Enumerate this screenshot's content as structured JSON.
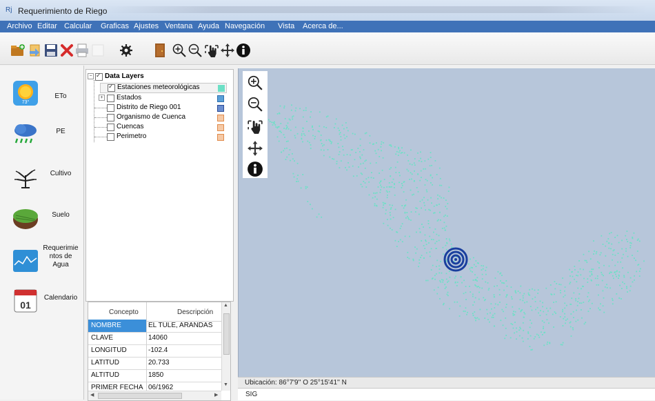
{
  "window": {
    "title": "Requerimiento de Riego"
  },
  "menu": [
    "Archivo",
    "Editar",
    "Calcular",
    "Graficas",
    "Ajustes",
    "Ventana",
    "Ayuda",
    "Navegación",
    "Vista",
    "Acerca de..."
  ],
  "toolbar_icons": [
    "open-folder-icon",
    "load-icon",
    "save-icon",
    "delete-icon",
    "print-icon",
    "blank-icon",
    "settings-icon",
    "exit-door-icon",
    "zoom-in-icon",
    "zoom-out-icon",
    "select-hand-icon",
    "pan-icon",
    "info-icon"
  ],
  "left_panel": [
    {
      "label": "ETo",
      "icon": "sun-thermometer-icon",
      "sublabel": "73°"
    },
    {
      "label": "PE",
      "icon": "rain-cloud-icon"
    },
    {
      "label": "Cultivo",
      "icon": "plant-icon"
    },
    {
      "label": "Suelo",
      "icon": "soil-icon"
    },
    {
      "label": "Requerimie ntos de Agua",
      "icon": "water-chart-icon"
    },
    {
      "label": "Calendario",
      "icon": "calendar-icon",
      "sublabel": "01"
    }
  ],
  "tree": {
    "root": "Data Layers",
    "layers": [
      {
        "label": "Estaciones meteorológicas",
        "checked": true,
        "color": "#6de0c6"
      },
      {
        "label": "Estados",
        "checked": false,
        "color": "#5aa0d8"
      },
      {
        "label": "Distrito de Riego 001",
        "checked": false,
        "color": "#6a8ed0"
      },
      {
        "label": "Organismo de Cuenca",
        "checked": false,
        "color": "#f0a878"
      },
      {
        "label": "Cuencas",
        "checked": false,
        "color": "#f0a878"
      },
      {
        "label": "Perimetro",
        "checked": false,
        "color": "#f0a878"
      }
    ]
  },
  "properties": {
    "headers": {
      "concept": "Concepto",
      "description": "Descripción"
    },
    "rows": [
      {
        "k": "NOMBRE",
        "v": "EL TULE, ARANDAS"
      },
      {
        "k": "CLAVE",
        "v": "14060"
      },
      {
        "k": "LONGITUD",
        "v": "-102.4"
      },
      {
        "k": "LATITUD",
        "v": "20.733"
      },
      {
        "k": "ALTITUD",
        "v": "1850"
      },
      {
        "k": "PRIMER FECHA",
        "v": "06/1962"
      }
    ]
  },
  "map": {
    "background": "#b7c6da",
    "station_color": "#6de0c6",
    "selected_color": "#1a3f9e",
    "status": "Ubicación: 86°7'9'' O  25°15'41'' N",
    "tab": "SIG"
  }
}
